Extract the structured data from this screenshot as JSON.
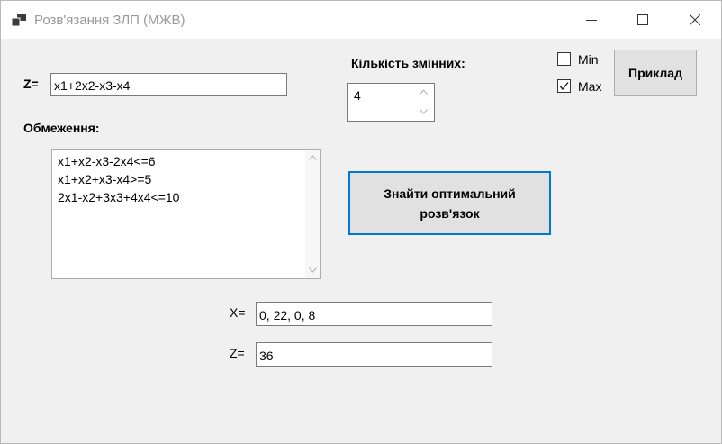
{
  "window": {
    "title": "Розв'язання ЗЛП (МЖВ)",
    "icon": "app-window-icon",
    "controls": [
      "minimize-icon",
      "maximize-icon",
      "close-icon"
    ]
  },
  "objective": {
    "label": "Z=",
    "value": "x1+2x2-x3-x4"
  },
  "constraints": {
    "label": "Обмеження:",
    "lines": [
      "x1+x2-x3-2x4<=6",
      "x1+x2+x3-x4>=5",
      "2x1-x2+3x3+4x4<=10"
    ]
  },
  "variables": {
    "label": "Кількість змінних:",
    "value": "4"
  },
  "mode": {
    "min_label": "Min",
    "max_label": "Max",
    "min_checked": false,
    "max_checked": true
  },
  "buttons": {
    "example": "Приклад",
    "solve_line1": "Знайти оптимальний",
    "solve_line2": "розв'язок"
  },
  "result": {
    "x_label": "X=",
    "x_value": "0, 22, 0, 8",
    "z_label": "Z=",
    "z_value": "36"
  },
  "colors": {
    "accent": "#0078d7",
    "window_bg": "#f0f0f0",
    "button_bg": "#e1e1e1"
  }
}
